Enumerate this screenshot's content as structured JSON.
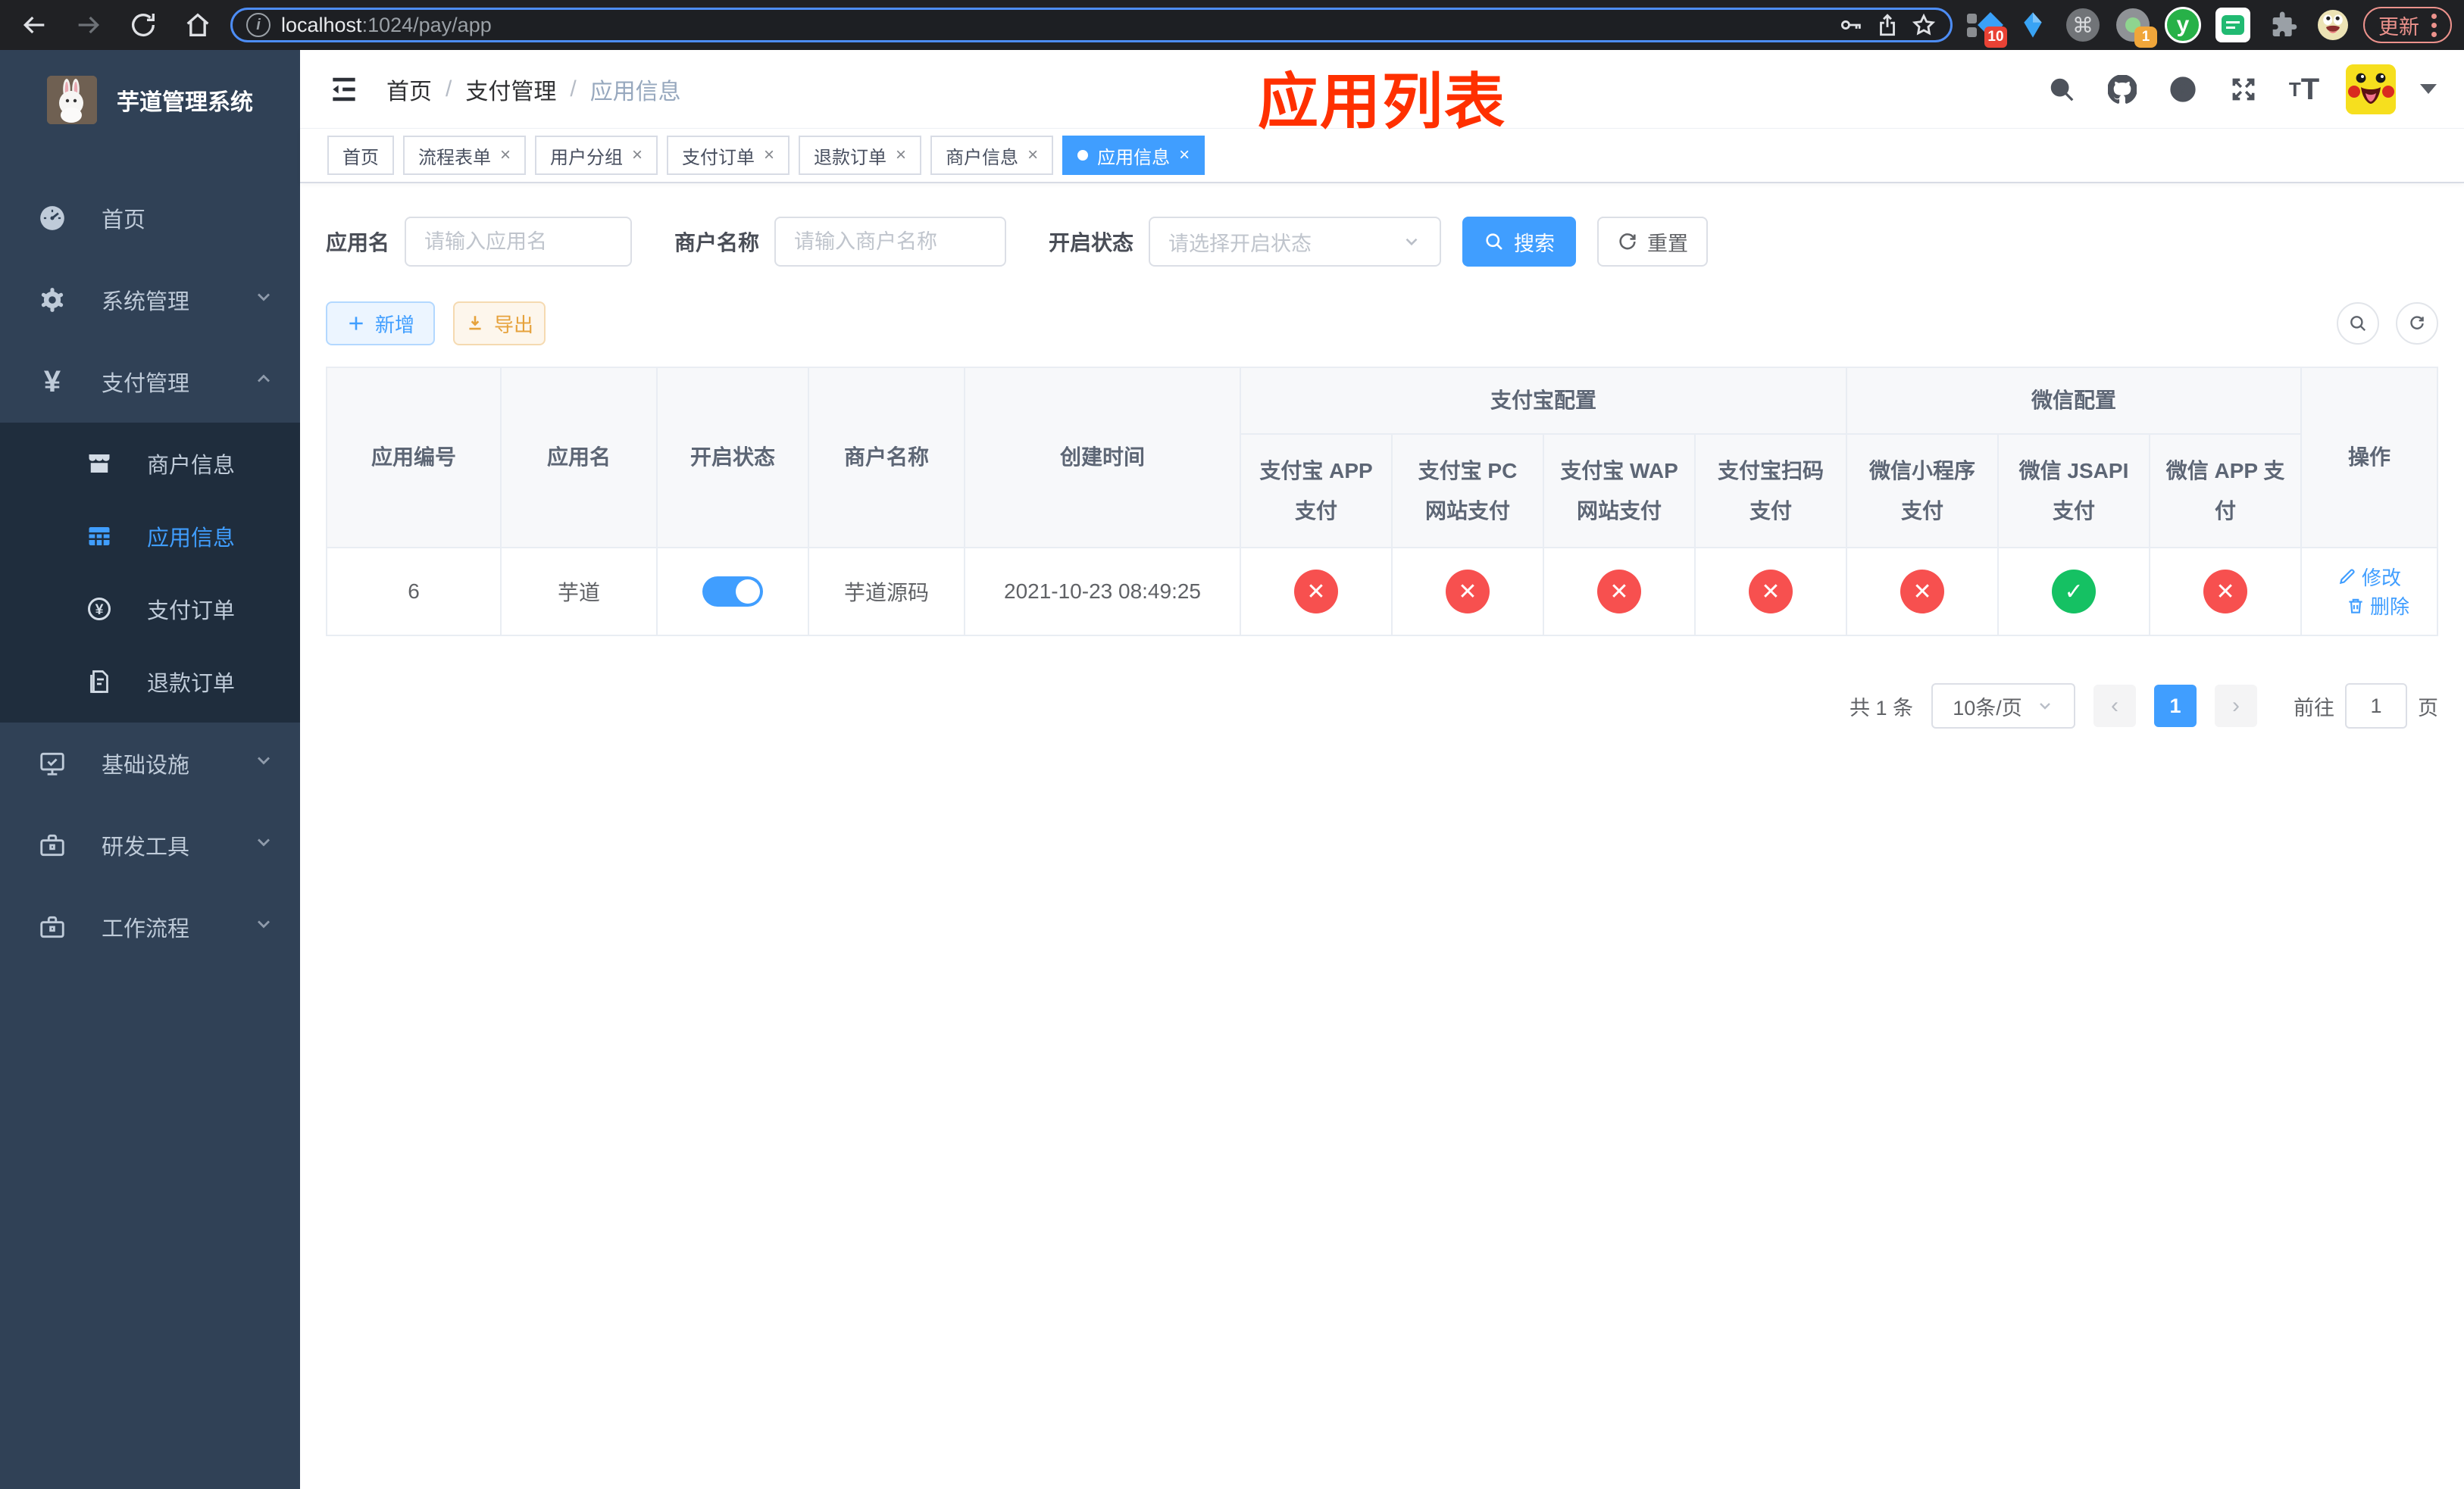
{
  "browser": {
    "url_host": "localhost",
    "url_path": ":1024/pay/app",
    "update_button": "更新",
    "ext_badge_1": "10",
    "ext_badge_2": "1"
  },
  "sidebar": {
    "title": "芋道管理系统",
    "menu": [
      {
        "label": "首页"
      },
      {
        "label": "系统管理"
      },
      {
        "label": "支付管理"
      },
      {
        "label": "基础设施"
      },
      {
        "label": "研发工具"
      },
      {
        "label": "工作流程"
      }
    ],
    "submenu": [
      {
        "label": "商户信息"
      },
      {
        "label": "应用信息"
      },
      {
        "label": "支付订单"
      },
      {
        "label": "退款订单"
      }
    ]
  },
  "navbar": {
    "breadcrumb": [
      "首页",
      "支付管理",
      "应用信息"
    ],
    "annotation": "应用列表"
  },
  "tabs": [
    {
      "label": "首页"
    },
    {
      "label": "流程表单"
    },
    {
      "label": "用户分组"
    },
    {
      "label": "支付订单"
    },
    {
      "label": "退款订单"
    },
    {
      "label": "商户信息"
    },
    {
      "label": "应用信息"
    }
  ],
  "filters": {
    "app_name_label": "应用名",
    "app_name_placeholder": "请输入应用名",
    "merchant_label": "商户名称",
    "merchant_placeholder": "请输入商户名称",
    "status_label": "开启状态",
    "status_placeholder": "请选择开启状态",
    "search": "搜索",
    "reset": "重置"
  },
  "toolbar": {
    "add": "新增",
    "export": "导出"
  },
  "table": {
    "columns": [
      "应用编号",
      "应用名",
      "开启状态",
      "商户名称",
      "创建时间"
    ],
    "groups": [
      {
        "label": "支付宝配置",
        "children": [
          "支付宝 APP 支付",
          "支付宝 PC 网站支付",
          "支付宝 WAP 网站支付",
          "支付宝扫码支付"
        ]
      },
      {
        "label": "微信配置",
        "children": [
          "微信小程序支付",
          "微信 JSAPI 支付",
          "微信 APP 支付"
        ]
      }
    ],
    "actions_column": "操作",
    "rows": [
      {
        "id": "6",
        "name": "芋道",
        "enabled": true,
        "merchant": "芋道源码",
        "created": "2021-10-23 08:49:25",
        "pay_status": [
          "no",
          "no",
          "no",
          "no",
          "no",
          "yes",
          "no"
        ],
        "edit": "修改",
        "delete": "删除"
      }
    ]
  },
  "pagination": {
    "total": "共 1 条",
    "page_size": "10条/页",
    "current_page": "1",
    "goto_label": "前往",
    "goto_value": "1",
    "goto_suffix": "页"
  },
  "colors": {
    "primary": "#409EFF",
    "success": "#15c163",
    "danger": "#f7504f",
    "warning": "#e6a23c",
    "annotation": "#ff3000"
  }
}
